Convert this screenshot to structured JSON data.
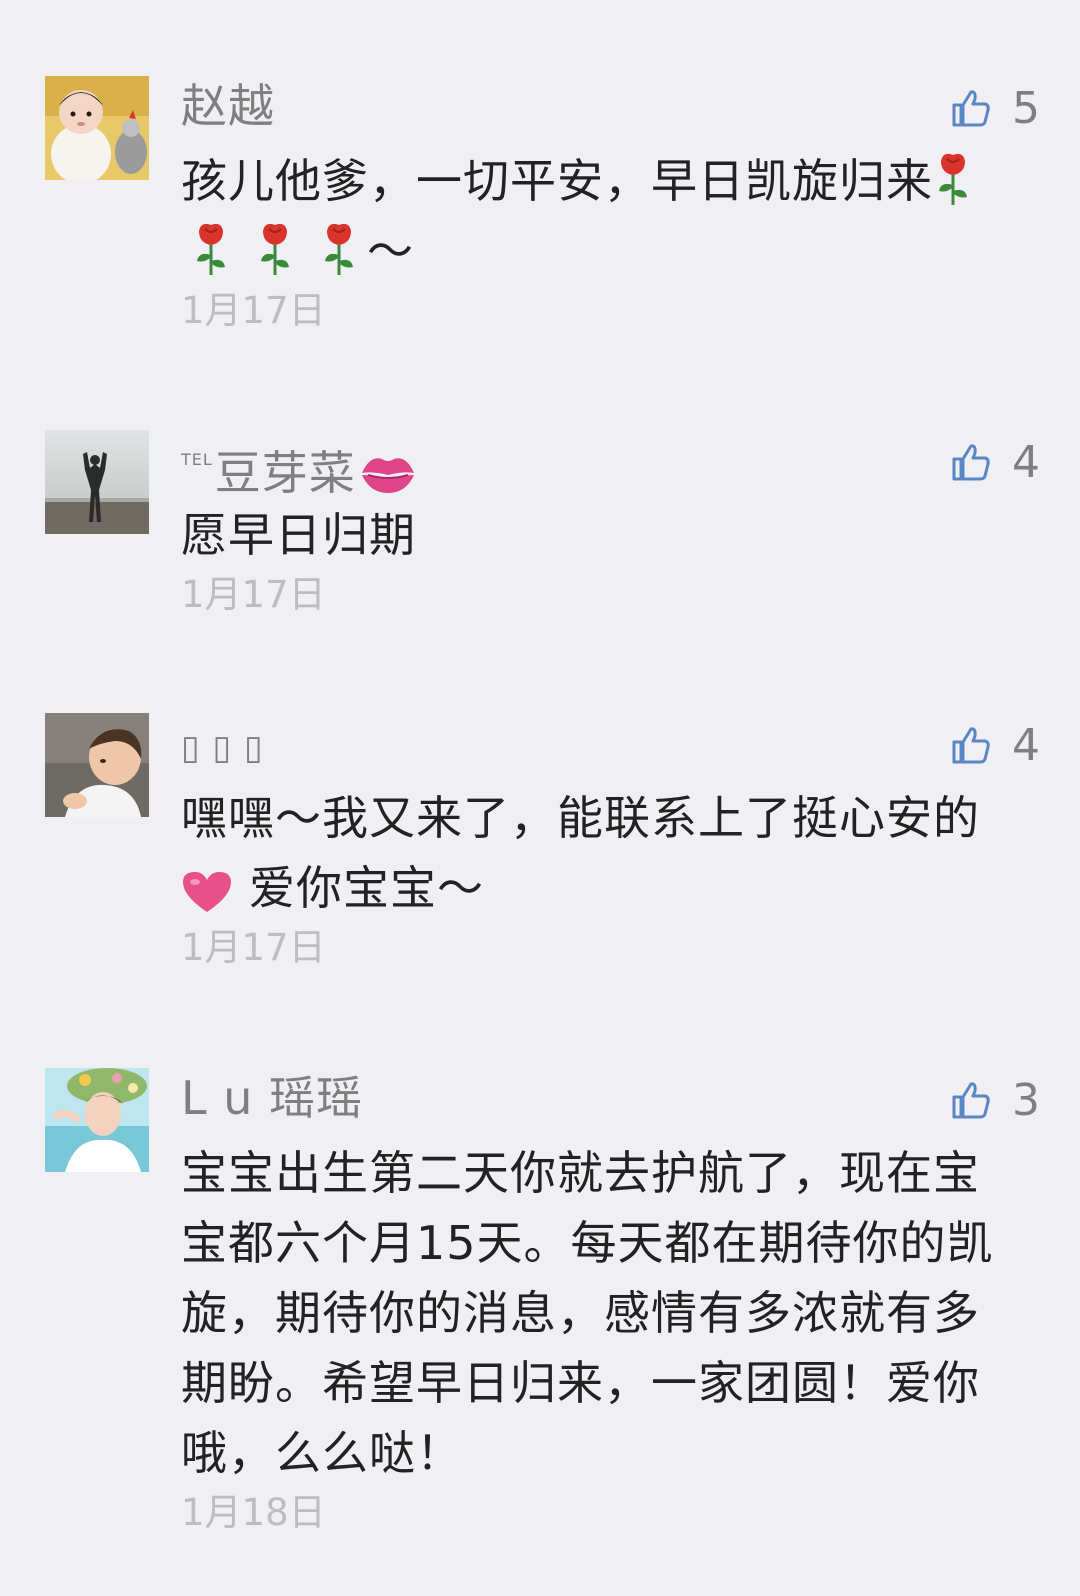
{
  "comments": [
    {
      "nickname": "赵越",
      "likes": "5",
      "lines": [
        "孩儿他爹，一切平安，早日凯旋归来",
        "～"
      ],
      "date": "1月17日"
    },
    {
      "nickname_prefix": "TEL",
      "nickname": "豆芽菜",
      "likes": "4",
      "lines": [
        "愿早日归期"
      ],
      "date": "1月17日"
    },
    {
      "nickname": "▯ ▯ ▯",
      "likes": "4",
      "lines": [
        "嘿嘿～我又来了，能联系上了挺心安的",
        "爱你宝宝～"
      ],
      "date": "1月17日"
    },
    {
      "nickname": "L u 瑶瑶",
      "likes": "3",
      "lines": [
        "宝宝出生第二天你就去护航了，现在宝",
        "宝都六个月15天。每天都在期待你的凯",
        "旋，期待你的消息，感情有多浓就有多",
        "期盼。希望早日归来，一家团圆！爱你",
        "哦，么么哒！"
      ],
      "date": "1月18日"
    }
  ],
  "icons": {
    "like": "thumbs-up-icon",
    "rose": "rose-emoji",
    "lips": "kiss-mark-emoji",
    "heart": "heart-emoji"
  },
  "colors": {
    "background": "#f0eff4",
    "nickname": "#7f7f7f",
    "content": "#222222",
    "date": "#bdbdbd",
    "like_icon": "#5b86c5"
  }
}
